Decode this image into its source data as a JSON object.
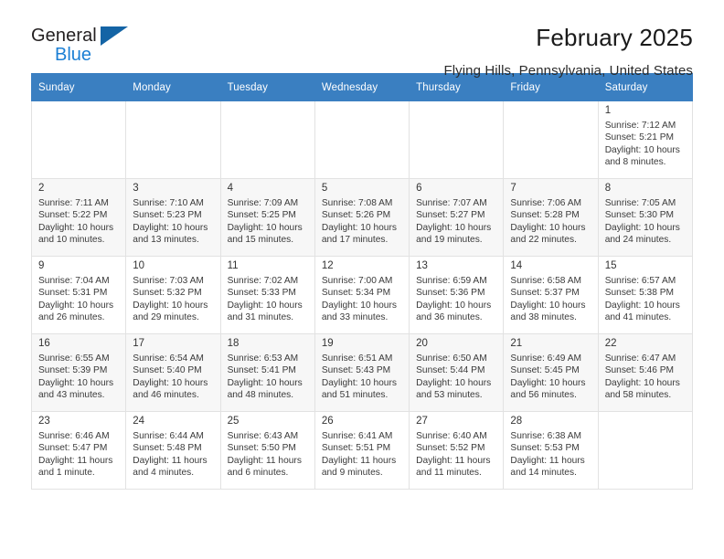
{
  "brand": {
    "line1": "General",
    "line2": "Blue",
    "triangle_color": "#1464a5"
  },
  "header": {
    "title": "February 2025",
    "subtitle": "Flying Hills, Pennsylvania, United States"
  },
  "theme": {
    "header_bg": "#3a7fc1",
    "header_text": "#ffffff",
    "shaded_row_bg": "#f7f7f7",
    "cell_border": "#e2e2e2"
  },
  "calendar": {
    "weekday_headers": [
      "Sunday",
      "Monday",
      "Tuesday",
      "Wednesday",
      "Thursday",
      "Friday",
      "Saturday"
    ],
    "weeks": [
      {
        "shaded": false,
        "days": [
          {
            "blank": true
          },
          {
            "blank": true
          },
          {
            "blank": true
          },
          {
            "blank": true
          },
          {
            "blank": true
          },
          {
            "blank": true
          },
          {
            "date": "1",
            "sunrise": "Sunrise: 7:12 AM",
            "sunset": "Sunset: 5:21 PM",
            "daylight_line1": "Daylight: 10 hours",
            "daylight_line2": "and 8 minutes."
          }
        ]
      },
      {
        "shaded": true,
        "days": [
          {
            "date": "2",
            "sunrise": "Sunrise: 7:11 AM",
            "sunset": "Sunset: 5:22 PM",
            "daylight_line1": "Daylight: 10 hours",
            "daylight_line2": "and 10 minutes."
          },
          {
            "date": "3",
            "sunrise": "Sunrise: 7:10 AM",
            "sunset": "Sunset: 5:23 PM",
            "daylight_line1": "Daylight: 10 hours",
            "daylight_line2": "and 13 minutes."
          },
          {
            "date": "4",
            "sunrise": "Sunrise: 7:09 AM",
            "sunset": "Sunset: 5:25 PM",
            "daylight_line1": "Daylight: 10 hours",
            "daylight_line2": "and 15 minutes."
          },
          {
            "date": "5",
            "sunrise": "Sunrise: 7:08 AM",
            "sunset": "Sunset: 5:26 PM",
            "daylight_line1": "Daylight: 10 hours",
            "daylight_line2": "and 17 minutes."
          },
          {
            "date": "6",
            "sunrise": "Sunrise: 7:07 AM",
            "sunset": "Sunset: 5:27 PM",
            "daylight_line1": "Daylight: 10 hours",
            "daylight_line2": "and 19 minutes."
          },
          {
            "date": "7",
            "sunrise": "Sunrise: 7:06 AM",
            "sunset": "Sunset: 5:28 PM",
            "daylight_line1": "Daylight: 10 hours",
            "daylight_line2": "and 22 minutes."
          },
          {
            "date": "8",
            "sunrise": "Sunrise: 7:05 AM",
            "sunset": "Sunset: 5:30 PM",
            "daylight_line1": "Daylight: 10 hours",
            "daylight_line2": "and 24 minutes."
          }
        ]
      },
      {
        "shaded": false,
        "days": [
          {
            "date": "9",
            "sunrise": "Sunrise: 7:04 AM",
            "sunset": "Sunset: 5:31 PM",
            "daylight_line1": "Daylight: 10 hours",
            "daylight_line2": "and 26 minutes."
          },
          {
            "date": "10",
            "sunrise": "Sunrise: 7:03 AM",
            "sunset": "Sunset: 5:32 PM",
            "daylight_line1": "Daylight: 10 hours",
            "daylight_line2": "and 29 minutes."
          },
          {
            "date": "11",
            "sunrise": "Sunrise: 7:02 AM",
            "sunset": "Sunset: 5:33 PM",
            "daylight_line1": "Daylight: 10 hours",
            "daylight_line2": "and 31 minutes."
          },
          {
            "date": "12",
            "sunrise": "Sunrise: 7:00 AM",
            "sunset": "Sunset: 5:34 PM",
            "daylight_line1": "Daylight: 10 hours",
            "daylight_line2": "and 33 minutes."
          },
          {
            "date": "13",
            "sunrise": "Sunrise: 6:59 AM",
            "sunset": "Sunset: 5:36 PM",
            "daylight_line1": "Daylight: 10 hours",
            "daylight_line2": "and 36 minutes."
          },
          {
            "date": "14",
            "sunrise": "Sunrise: 6:58 AM",
            "sunset": "Sunset: 5:37 PM",
            "daylight_line1": "Daylight: 10 hours",
            "daylight_line2": "and 38 minutes."
          },
          {
            "date": "15",
            "sunrise": "Sunrise: 6:57 AM",
            "sunset": "Sunset: 5:38 PM",
            "daylight_line1": "Daylight: 10 hours",
            "daylight_line2": "and 41 minutes."
          }
        ]
      },
      {
        "shaded": true,
        "days": [
          {
            "date": "16",
            "sunrise": "Sunrise: 6:55 AM",
            "sunset": "Sunset: 5:39 PM",
            "daylight_line1": "Daylight: 10 hours",
            "daylight_line2": "and 43 minutes."
          },
          {
            "date": "17",
            "sunrise": "Sunrise: 6:54 AM",
            "sunset": "Sunset: 5:40 PM",
            "daylight_line1": "Daylight: 10 hours",
            "daylight_line2": "and 46 minutes."
          },
          {
            "date": "18",
            "sunrise": "Sunrise: 6:53 AM",
            "sunset": "Sunset: 5:41 PM",
            "daylight_line1": "Daylight: 10 hours",
            "daylight_line2": "and 48 minutes."
          },
          {
            "date": "19",
            "sunrise": "Sunrise: 6:51 AM",
            "sunset": "Sunset: 5:43 PM",
            "daylight_line1": "Daylight: 10 hours",
            "daylight_line2": "and 51 minutes."
          },
          {
            "date": "20",
            "sunrise": "Sunrise: 6:50 AM",
            "sunset": "Sunset: 5:44 PM",
            "daylight_line1": "Daylight: 10 hours",
            "daylight_line2": "and 53 minutes."
          },
          {
            "date": "21",
            "sunrise": "Sunrise: 6:49 AM",
            "sunset": "Sunset: 5:45 PM",
            "daylight_line1": "Daylight: 10 hours",
            "daylight_line2": "and 56 minutes."
          },
          {
            "date": "22",
            "sunrise": "Sunrise: 6:47 AM",
            "sunset": "Sunset: 5:46 PM",
            "daylight_line1": "Daylight: 10 hours",
            "daylight_line2": "and 58 minutes."
          }
        ]
      },
      {
        "shaded": false,
        "days": [
          {
            "date": "23",
            "sunrise": "Sunrise: 6:46 AM",
            "sunset": "Sunset: 5:47 PM",
            "daylight_line1": "Daylight: 11 hours",
            "daylight_line2": "and 1 minute."
          },
          {
            "date": "24",
            "sunrise": "Sunrise: 6:44 AM",
            "sunset": "Sunset: 5:48 PM",
            "daylight_line1": "Daylight: 11 hours",
            "daylight_line2": "and 4 minutes."
          },
          {
            "date": "25",
            "sunrise": "Sunrise: 6:43 AM",
            "sunset": "Sunset: 5:50 PM",
            "daylight_line1": "Daylight: 11 hours",
            "daylight_line2": "and 6 minutes."
          },
          {
            "date": "26",
            "sunrise": "Sunrise: 6:41 AM",
            "sunset": "Sunset: 5:51 PM",
            "daylight_line1": "Daylight: 11 hours",
            "daylight_line2": "and 9 minutes."
          },
          {
            "date": "27",
            "sunrise": "Sunrise: 6:40 AM",
            "sunset": "Sunset: 5:52 PM",
            "daylight_line1": "Daylight: 11 hours",
            "daylight_line2": "and 11 minutes."
          },
          {
            "date": "28",
            "sunrise": "Sunrise: 6:38 AM",
            "sunset": "Sunset: 5:53 PM",
            "daylight_line1": "Daylight: 11 hours",
            "daylight_line2": "and 14 minutes."
          },
          {
            "blank": true
          }
        ]
      }
    ]
  }
}
